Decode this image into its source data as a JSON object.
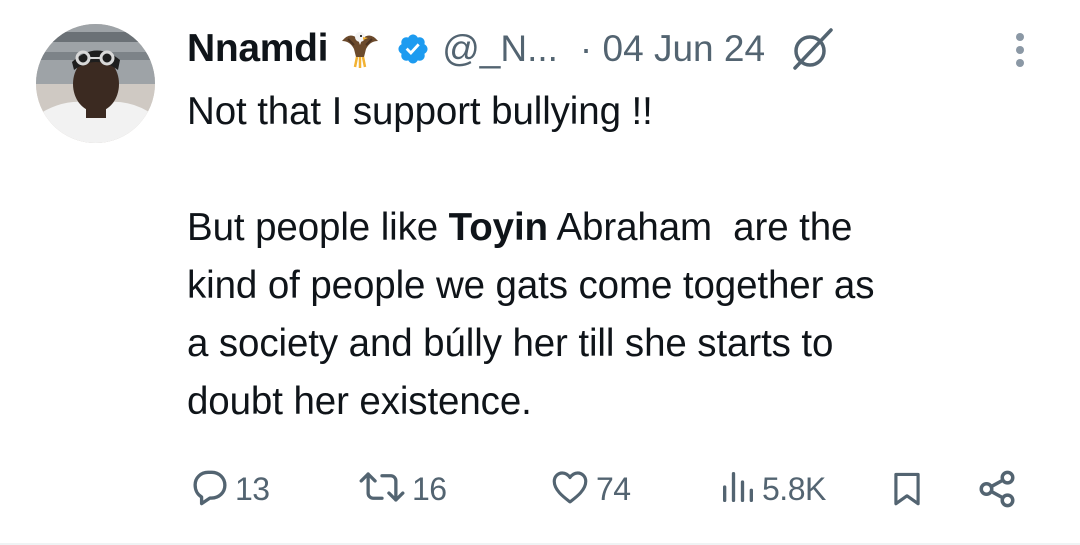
{
  "tweet": {
    "author_name": "Nnamdi",
    "handle": "@_N...",
    "date": "· 04 Jun 24",
    "paragraph1": "Not that I support bullying !!",
    "para2_prefix": "But people like ",
    "para2_bold": "Toyin",
    "para2_line1_rest": " Abraham  are the",
    "para2_line2": "kind of people we gats come together as",
    "para2_line3": "a society and búlly her till she starts to",
    "para2_line4": "doubt her existence."
  },
  "stats": {
    "replies": "13",
    "reposts": "16",
    "likes": "74",
    "views": "5.8K"
  },
  "icons": {
    "avatar": "avatar-photo",
    "emoji": "eagle-emoji-icon",
    "verified": "verified-badge-icon",
    "grok": "grok-icon",
    "more": "more-options-icon",
    "reply": "reply-icon",
    "repost": "repost-icon",
    "like": "heart-icon",
    "views": "views-icon",
    "bookmark": "bookmark-icon",
    "share": "share-icon"
  },
  "colors": {
    "text": "#0f1419",
    "secondary": "#536471",
    "verified": "#1d9bf0"
  }
}
